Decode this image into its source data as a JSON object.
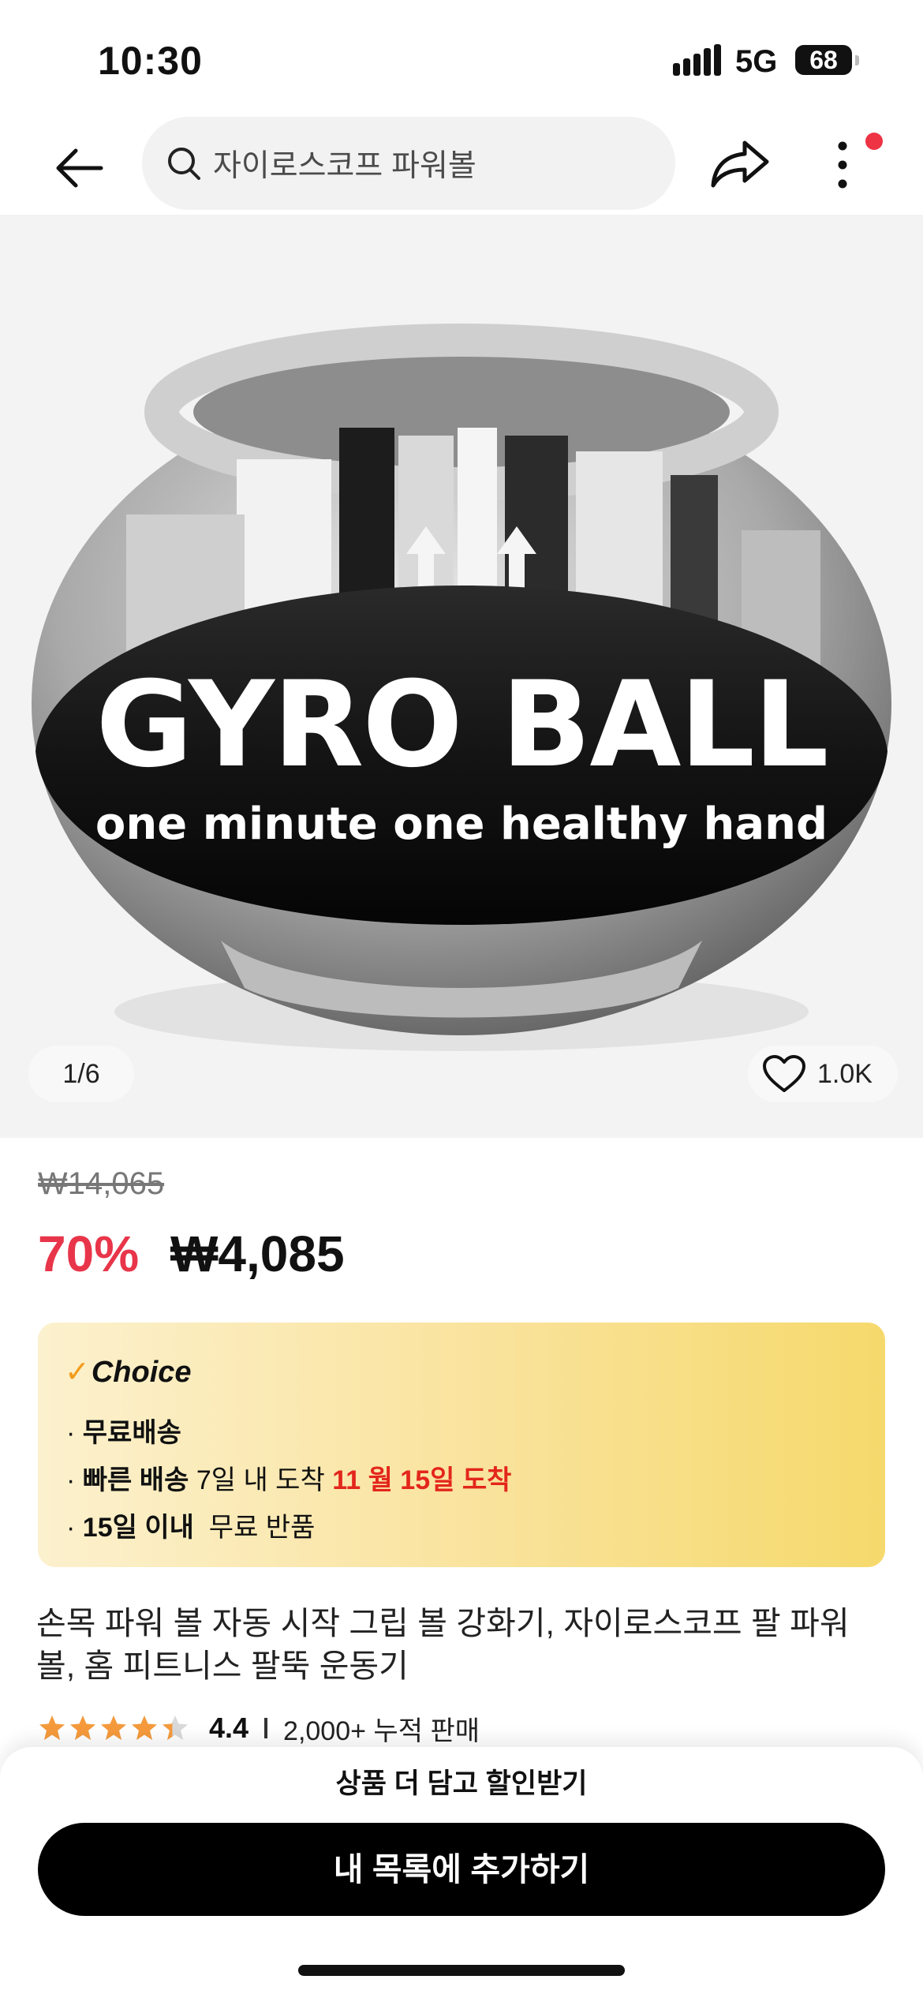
{
  "status_bar": {
    "time": "10:30",
    "network": "5G",
    "battery": "68"
  },
  "top_bar": {
    "search_text": "자이로스코프 파워볼"
  },
  "product_image": {
    "brand_text": "GYRO BALL",
    "tagline": "one minute one healthy hand",
    "counter": "1/6",
    "favorites": "1.0K"
  },
  "price": {
    "original": "₩14,065",
    "discount": "70%",
    "current": "₩4,085"
  },
  "choice": {
    "logo": "Choice",
    "bullet": "·",
    "free_shipping": "무료배송",
    "fast_label": "빠른 배송",
    "fast_desc": "7일 내 도착",
    "arrival": "11 월 15일 도착",
    "returns_label": "15일 이내",
    "returns_desc": "무료 반품"
  },
  "product": {
    "title": "손목 파워 볼 자동 시작 그립 볼 강화기, 자이로스코프 팔 파워 볼, 홈 피트니스 팔뚝 운동기",
    "rating": "4.4",
    "rating_value": 4.4,
    "sold": "2,000+ 누적 판매"
  },
  "bottom": {
    "promo": "상품 더 담고 할인받기",
    "add_button": "내 목록에 추가하기"
  },
  "colors": {
    "accent_red": "#e8354a",
    "arrival_red": "#e3261b",
    "star": "#f59a3c",
    "choice_yellow": "#f6d96c"
  }
}
